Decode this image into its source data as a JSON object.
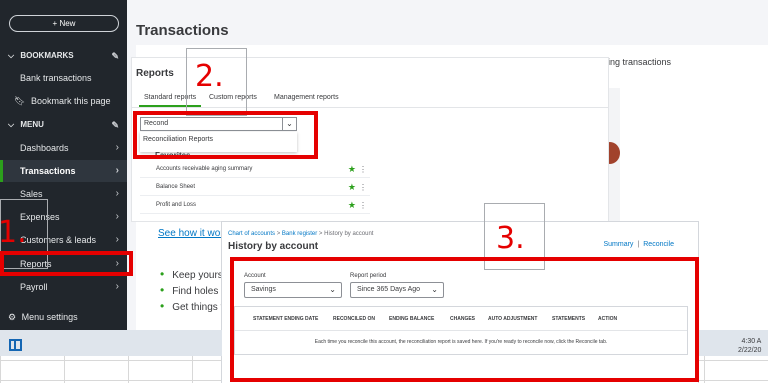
{
  "sidebar": {
    "new_label": "+ New",
    "bookmarks_label": "BOOKMARKS",
    "bank_transactions_label": "Bank transactions",
    "bookmark_page_label": "Bookmark this page",
    "menu_label": "MENU",
    "items": [
      {
        "label": "Dashboards"
      },
      {
        "label": "Transactions"
      },
      {
        "label": "Sales"
      },
      {
        "label": "Expenses"
      },
      {
        "label": "Customers & leads"
      },
      {
        "label": "Reports"
      },
      {
        "label": "Payroll"
      }
    ],
    "settings_label": "Menu settings"
  },
  "main": {
    "title": "Transactions",
    "right_text": "ing transactions",
    "see_how_label": "See how it wor",
    "bullets": [
      "Keep yours",
      "Find holes",
      "Get things t"
    ]
  },
  "reports": {
    "title": "Reports",
    "tabs": [
      "Standard reports",
      "Custom reports",
      "Management reports"
    ],
    "search_value": "Recond",
    "suggestion": "Reconciliation Reports",
    "favorites_label": "Favorites",
    "favorite_items": [
      "Accounts receivable aging summary",
      "Balance Sheet",
      "Profit and Loss"
    ]
  },
  "history": {
    "breadcrumb": {
      "chart": "Chart of accounts",
      "sep": ">",
      "register": "Bank register",
      "current": "History by account"
    },
    "title": "History by account",
    "links": {
      "summary": "Summary",
      "sep": "|",
      "reconcile": "Reconcile"
    },
    "account_label": "Account",
    "account_value": "Savings",
    "period_label": "Report period",
    "period_value": "Since 365 Days Ago",
    "columns": [
      "STATEMENT ENDING DATE",
      "RECONCILED ON",
      "ENDING BALANCE",
      "CHANGES",
      "AUTO ADJUSTMENT",
      "STATEMENTS",
      "ACTION"
    ],
    "empty_message": "Each time you reconcile this account, the reconciliation report is saved here. If you're ready to reconcile now, click the Reconcile tab."
  },
  "taskbar": {
    "time": "4:30 A",
    "date": "2/22/20"
  },
  "annotations": {
    "step1": "1.",
    "step2": "2.",
    "step3": "3."
  },
  "colors": {
    "accent_green": "#2ca01c",
    "link_blue": "#0077c5",
    "annotation_red": "#e50000",
    "sidebar_bg": "#21262c"
  }
}
